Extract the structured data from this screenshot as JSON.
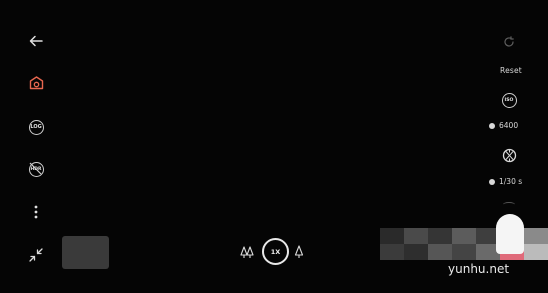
{
  "left_bar": {
    "back_icon": "arrow-left-icon",
    "mode_icon": "camera-mode-icon",
    "log_label": "LOG",
    "hdr_label": "HDR",
    "more_icon": "more-vertical-icon",
    "collapse_icon": "collapse-icon"
  },
  "right_bar": {
    "reset_label": "Reset",
    "iso_badge": "ISO",
    "iso_value": "6400",
    "shutter_value": "1/30 s"
  },
  "bottom_bar": {
    "zoom_label": "1X"
  },
  "watermark": "yunhu.net",
  "colors": {
    "background": "#050505",
    "accent": "#e8674f",
    "foreground": "#d8d8d8"
  }
}
